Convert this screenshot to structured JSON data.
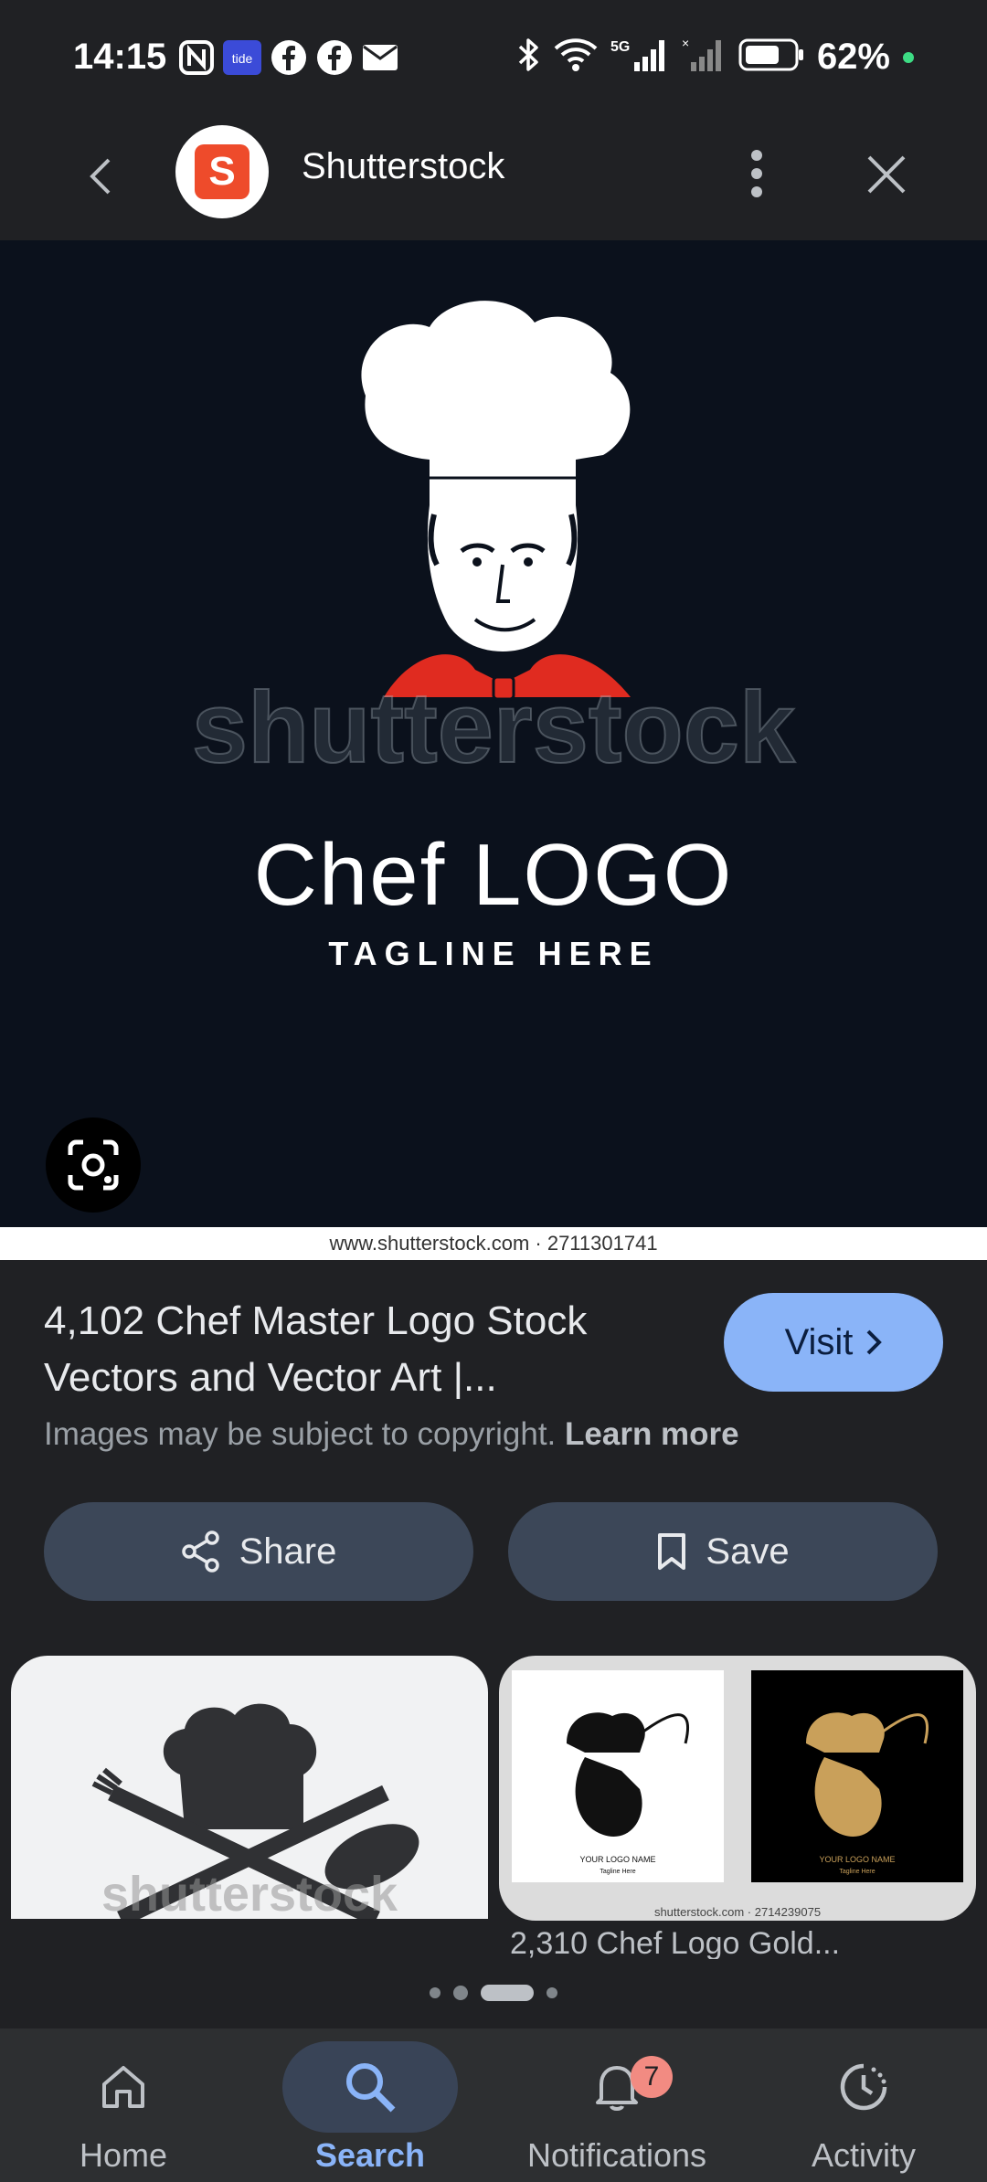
{
  "status_bar": {
    "time": "14:15",
    "left_icons": [
      "nfc-icon",
      "tide-icon",
      "facebook-icon",
      "facebook-icon",
      "mail-icon"
    ],
    "tide_label": "tide",
    "network_label": "5G",
    "battery_percent": "62%"
  },
  "header": {
    "site_name": "Shutterstock",
    "logo_letter": "S"
  },
  "main_image": {
    "logo_title": "Chef LOGO",
    "tagline": "TAGLINE HERE",
    "watermark": "shutterstock",
    "source_url": "www.shutterstock.com · 2711301741"
  },
  "result": {
    "title": "4,102 Chef Master Logo Stock Vectors and Vector Art |...",
    "visit_label": "Visit",
    "copyright_text": "Images may be subject to copyright.",
    "learn_more": "Learn more",
    "share_label": "Share",
    "save_label": "Save"
  },
  "related": {
    "card1_watermark": "shutterstock",
    "card2_logo_text": "YOUR LOGO NAME",
    "card2_tagline": "Tagline Here",
    "card2_url": "shutterstock.com · 2714239075",
    "card2_caption": "2,310 Chef Logo Gold..."
  },
  "bottom_nav": {
    "home": "Home",
    "search": "Search",
    "notifications": "Notifications",
    "notifications_badge": "7",
    "activity": "Activity"
  },
  "colors": {
    "accent": "#8ab4f8",
    "brand_red": "#ee4b2b",
    "image_bg": "#0b111c"
  }
}
